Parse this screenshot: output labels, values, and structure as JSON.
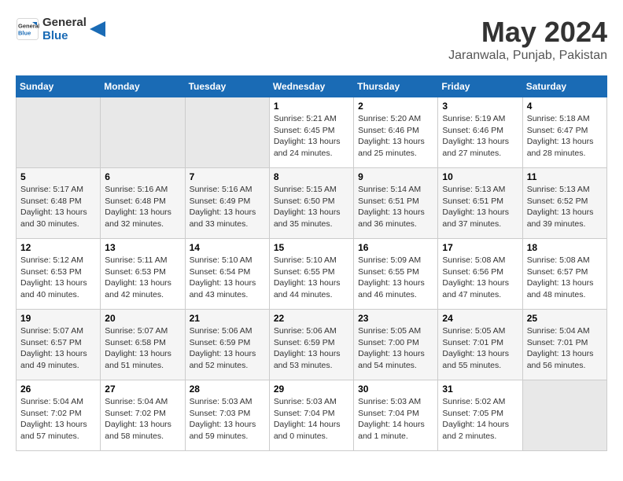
{
  "header": {
    "logo_line1": "General",
    "logo_line2": "Blue",
    "month_title": "May 2024",
    "location": "Jaranwala, Punjab, Pakistan"
  },
  "weekdays": [
    "Sunday",
    "Monday",
    "Tuesday",
    "Wednesday",
    "Thursday",
    "Friday",
    "Saturday"
  ],
  "weeks": [
    [
      {
        "day": "",
        "info": ""
      },
      {
        "day": "",
        "info": ""
      },
      {
        "day": "",
        "info": ""
      },
      {
        "day": "1",
        "info": "Sunrise: 5:21 AM\nSunset: 6:45 PM\nDaylight: 13 hours\nand 24 minutes."
      },
      {
        "day": "2",
        "info": "Sunrise: 5:20 AM\nSunset: 6:46 PM\nDaylight: 13 hours\nand 25 minutes."
      },
      {
        "day": "3",
        "info": "Sunrise: 5:19 AM\nSunset: 6:46 PM\nDaylight: 13 hours\nand 27 minutes."
      },
      {
        "day": "4",
        "info": "Sunrise: 5:18 AM\nSunset: 6:47 PM\nDaylight: 13 hours\nand 28 minutes."
      }
    ],
    [
      {
        "day": "5",
        "info": "Sunrise: 5:17 AM\nSunset: 6:48 PM\nDaylight: 13 hours\nand 30 minutes."
      },
      {
        "day": "6",
        "info": "Sunrise: 5:16 AM\nSunset: 6:48 PM\nDaylight: 13 hours\nand 32 minutes."
      },
      {
        "day": "7",
        "info": "Sunrise: 5:16 AM\nSunset: 6:49 PM\nDaylight: 13 hours\nand 33 minutes."
      },
      {
        "day": "8",
        "info": "Sunrise: 5:15 AM\nSunset: 6:50 PM\nDaylight: 13 hours\nand 35 minutes."
      },
      {
        "day": "9",
        "info": "Sunrise: 5:14 AM\nSunset: 6:51 PM\nDaylight: 13 hours\nand 36 minutes."
      },
      {
        "day": "10",
        "info": "Sunrise: 5:13 AM\nSunset: 6:51 PM\nDaylight: 13 hours\nand 37 minutes."
      },
      {
        "day": "11",
        "info": "Sunrise: 5:13 AM\nSunset: 6:52 PM\nDaylight: 13 hours\nand 39 minutes."
      }
    ],
    [
      {
        "day": "12",
        "info": "Sunrise: 5:12 AM\nSunset: 6:53 PM\nDaylight: 13 hours\nand 40 minutes."
      },
      {
        "day": "13",
        "info": "Sunrise: 5:11 AM\nSunset: 6:53 PM\nDaylight: 13 hours\nand 42 minutes."
      },
      {
        "day": "14",
        "info": "Sunrise: 5:10 AM\nSunset: 6:54 PM\nDaylight: 13 hours\nand 43 minutes."
      },
      {
        "day": "15",
        "info": "Sunrise: 5:10 AM\nSunset: 6:55 PM\nDaylight: 13 hours\nand 44 minutes."
      },
      {
        "day": "16",
        "info": "Sunrise: 5:09 AM\nSunset: 6:55 PM\nDaylight: 13 hours\nand 46 minutes."
      },
      {
        "day": "17",
        "info": "Sunrise: 5:08 AM\nSunset: 6:56 PM\nDaylight: 13 hours\nand 47 minutes."
      },
      {
        "day": "18",
        "info": "Sunrise: 5:08 AM\nSunset: 6:57 PM\nDaylight: 13 hours\nand 48 minutes."
      }
    ],
    [
      {
        "day": "19",
        "info": "Sunrise: 5:07 AM\nSunset: 6:57 PM\nDaylight: 13 hours\nand 49 minutes."
      },
      {
        "day": "20",
        "info": "Sunrise: 5:07 AM\nSunset: 6:58 PM\nDaylight: 13 hours\nand 51 minutes."
      },
      {
        "day": "21",
        "info": "Sunrise: 5:06 AM\nSunset: 6:59 PM\nDaylight: 13 hours\nand 52 minutes."
      },
      {
        "day": "22",
        "info": "Sunrise: 5:06 AM\nSunset: 6:59 PM\nDaylight: 13 hours\nand 53 minutes."
      },
      {
        "day": "23",
        "info": "Sunrise: 5:05 AM\nSunset: 7:00 PM\nDaylight: 13 hours\nand 54 minutes."
      },
      {
        "day": "24",
        "info": "Sunrise: 5:05 AM\nSunset: 7:01 PM\nDaylight: 13 hours\nand 55 minutes."
      },
      {
        "day": "25",
        "info": "Sunrise: 5:04 AM\nSunset: 7:01 PM\nDaylight: 13 hours\nand 56 minutes."
      }
    ],
    [
      {
        "day": "26",
        "info": "Sunrise: 5:04 AM\nSunset: 7:02 PM\nDaylight: 13 hours\nand 57 minutes."
      },
      {
        "day": "27",
        "info": "Sunrise: 5:04 AM\nSunset: 7:02 PM\nDaylight: 13 hours\nand 58 minutes."
      },
      {
        "day": "28",
        "info": "Sunrise: 5:03 AM\nSunset: 7:03 PM\nDaylight: 13 hours\nand 59 minutes."
      },
      {
        "day": "29",
        "info": "Sunrise: 5:03 AM\nSunset: 7:04 PM\nDaylight: 14 hours\nand 0 minutes."
      },
      {
        "day": "30",
        "info": "Sunrise: 5:03 AM\nSunset: 7:04 PM\nDaylight: 14 hours\nand 1 minute."
      },
      {
        "day": "31",
        "info": "Sunrise: 5:02 AM\nSunset: 7:05 PM\nDaylight: 14 hours\nand 2 minutes."
      },
      {
        "day": "",
        "info": ""
      }
    ]
  ]
}
